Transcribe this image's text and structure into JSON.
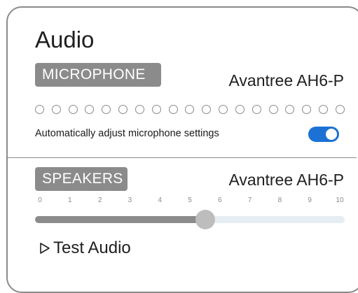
{
  "panel": {
    "title": "Audio"
  },
  "microphone": {
    "section_label": "MICROPHONE",
    "device": "Avantree AH6-P",
    "level_indicator_count": 19,
    "auto_adjust_label": "Automatically adjust microphone settings",
    "auto_adjust_enabled": true
  },
  "speakers": {
    "section_label": "SPEAKERS",
    "device": "Avantree AH6-P",
    "volume_ticks": [
      "0",
      "1",
      "2",
      "3",
      "4",
      "5",
      "6",
      "7",
      "8",
      "9",
      "10"
    ],
    "volume_min": 0,
    "volume_max": 10,
    "volume_value": 5.5,
    "test_audio_label": "Test Audio"
  },
  "icons": {
    "test_audio": "play-outline-icon"
  },
  "colors": {
    "accent": "#1c72d4",
    "pill_background": "#8b8b8b",
    "slider_fill": "#8b8b8b",
    "slider_track": "#e6edf3",
    "slider_thumb": "#bdbdbd"
  }
}
